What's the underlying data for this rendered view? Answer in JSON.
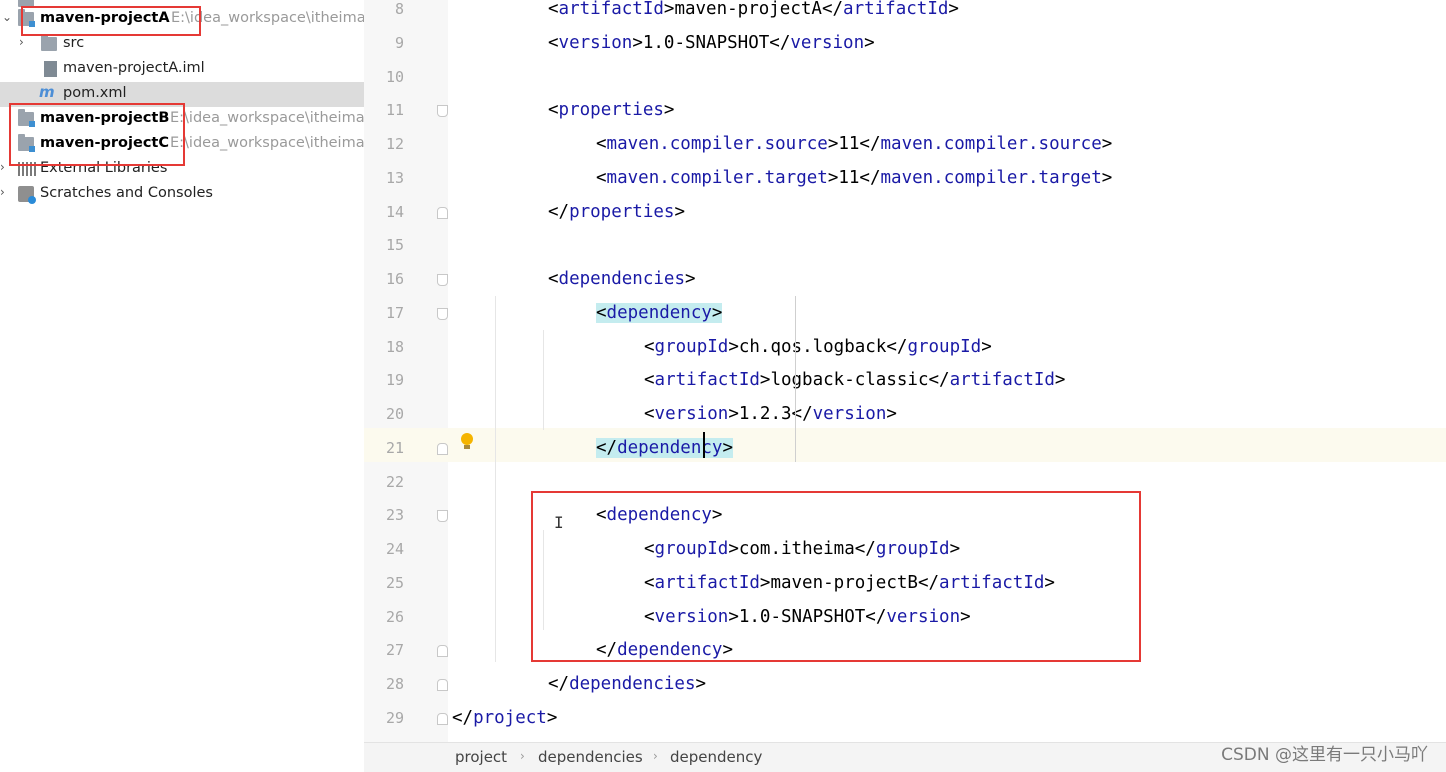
{
  "project_tree": {
    "items": [
      {
        "name": "maven-projectA",
        "path": "E:\\idea_workspace\\itheima"
      },
      {
        "name": "src"
      },
      {
        "name": "maven-projectA.iml"
      },
      {
        "name": "pom.xml",
        "icon": "m"
      },
      {
        "name": "maven-projectB",
        "path": "E:\\idea_workspace\\itheima"
      },
      {
        "name": "maven-projectC",
        "path": "E:\\idea_workspace\\itheima"
      },
      {
        "name": "External Libraries"
      },
      {
        "name": "Scratches and Consoles"
      }
    ]
  },
  "editor": {
    "lines": [
      {
        "num": "8",
        "text": "<artifactId>maven-projectA</artifactId>"
      },
      {
        "num": "9",
        "text": "<version>1.0-SNAPSHOT</version>"
      },
      {
        "num": "10",
        "text": ""
      },
      {
        "num": "11",
        "text": "<properties>"
      },
      {
        "num": "12",
        "text": "<maven.compiler.source>11</maven.compiler.source>"
      },
      {
        "num": "13",
        "text": "<maven.compiler.target>11</maven.compiler.target>"
      },
      {
        "num": "14",
        "text": "</properties>"
      },
      {
        "num": "15",
        "text": ""
      },
      {
        "num": "16",
        "text": "<dependencies>"
      },
      {
        "num": "17",
        "text": "<dependency>"
      },
      {
        "num": "18",
        "text": "<groupId>ch.qos.logback</groupId>"
      },
      {
        "num": "19",
        "text": "<artifactId>logback-classic</artifactId>"
      },
      {
        "num": "20",
        "text": "<version>1.2.3</version>"
      },
      {
        "num": "21",
        "text": "</dependency>"
      },
      {
        "num": "22",
        "text": ""
      },
      {
        "num": "23",
        "text": "<dependency>"
      },
      {
        "num": "24",
        "text": "<groupId>com.itheima</groupId>"
      },
      {
        "num": "25",
        "text": "<artifactId>maven-projectB</artifactId>"
      },
      {
        "num": "26",
        "text": "<version>1.0-SNAPSHOT</version>"
      },
      {
        "num": "27",
        "text": "</dependency>"
      },
      {
        "num": "28",
        "text": "</dependencies>"
      },
      {
        "num": "29",
        "text": "</project>"
      }
    ]
  },
  "breadcrumbs": [
    "project",
    "dependencies",
    "dependency"
  ],
  "watermark": "CSDN @这里有一只小马吖",
  "colors": {
    "tag": "#1a1aa6",
    "highlight_box": "#e53935",
    "tag_match": "#c4ecef"
  }
}
